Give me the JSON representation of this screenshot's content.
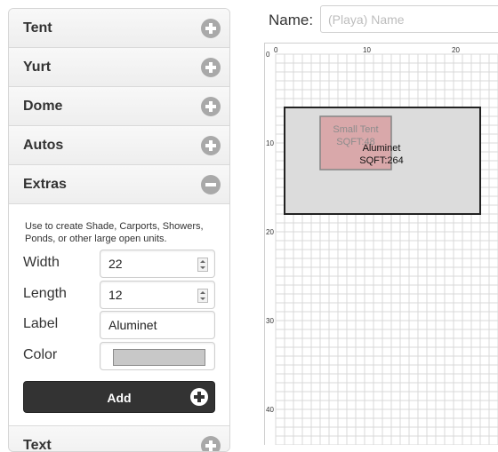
{
  "sidebar": {
    "sections": [
      {
        "title": "Tent",
        "icon": "plus-circle-icon"
      },
      {
        "title": "Yurt",
        "icon": "plus-circle-icon"
      },
      {
        "title": "Dome",
        "icon": "plus-circle-icon"
      },
      {
        "title": "Autos",
        "icon": "plus-circle-icon"
      },
      {
        "title": "Extras",
        "icon": "minus-circle-icon"
      },
      {
        "title": "Text",
        "icon": "plus-circle-icon"
      }
    ],
    "extras": {
      "description": "Use to create Shade, Carports, Showers, Ponds, or other large open units.",
      "width_label": "Width",
      "width_value": "22",
      "length_label": "Length",
      "length_value": "12",
      "label_label": "Label",
      "label_value": "Aluminet",
      "color_label": "Color",
      "color_value": "#c8c8c8",
      "add_label": "Add"
    }
  },
  "header": {
    "name_label": "Name:",
    "name_placeholder": "(Playa) Name"
  },
  "map": {
    "x_ticks": [
      "0",
      "10",
      "20"
    ],
    "y_ticks": [
      "0",
      "10",
      "20",
      "30",
      "40"
    ],
    "shapes": [
      {
        "label": "Aluminet",
        "sqft_label": "SQFT:264",
        "fill": "#dcdcdc",
        "stroke": "#222222",
        "col": 1,
        "row": 6,
        "w": 22,
        "h": 12
      },
      {
        "label": "Small Tent",
        "sqft_label": "SQFT:48",
        "fill": "#d9a0a2",
        "stroke": "#777777",
        "col": 5,
        "row": 7,
        "w": 8,
        "h": 6
      }
    ],
    "grid_color": "#d8d8d8"
  }
}
